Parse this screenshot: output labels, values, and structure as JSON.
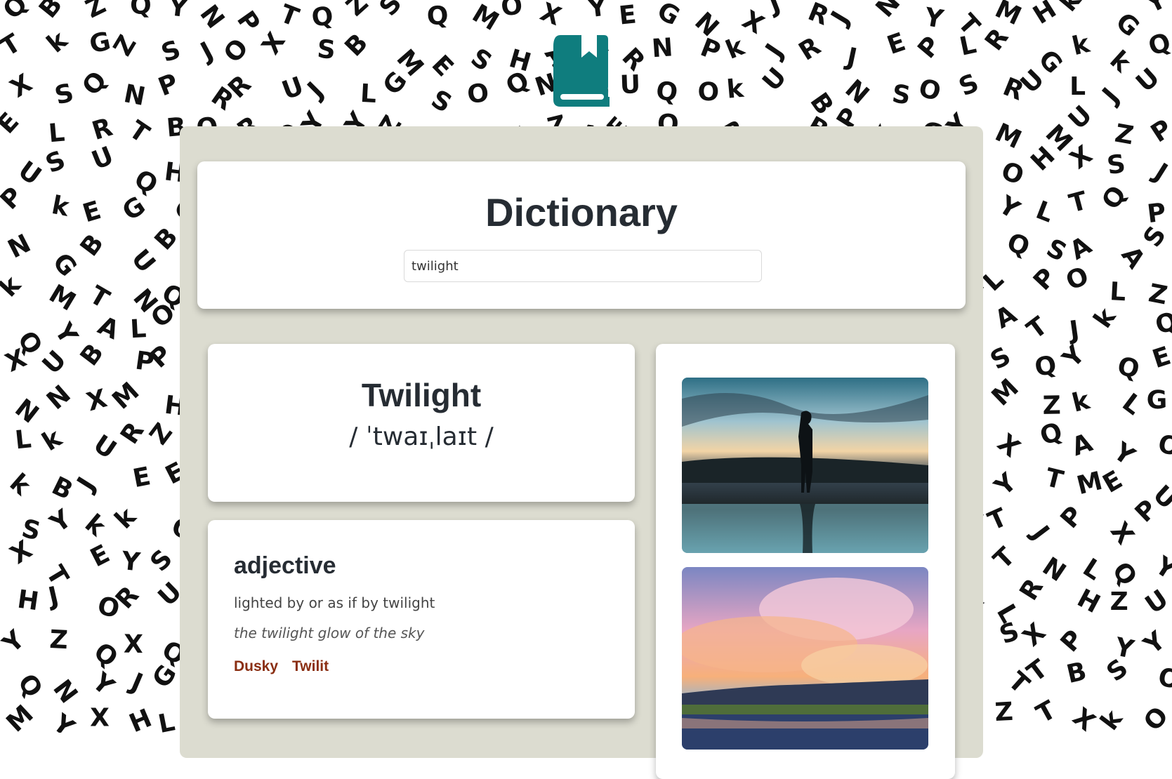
{
  "app": {
    "logo_icon": "bookmarked-book-icon",
    "accent_color": "#0f7d7e",
    "background_letters": "kOGPQTUJEYLAXMRZHBSN"
  },
  "header": {
    "title": "Dictionary",
    "search_value": "twilight"
  },
  "entry": {
    "word": "Twilight",
    "phonetic": "/ ˈtwaɪˌlaɪt /"
  },
  "meaning": {
    "part_of_speech": "adjective",
    "definition": "lighted by or as if by twilight",
    "example": "the twilight glow of the sky",
    "synonyms": [
      "Dusky",
      "Twilit"
    ]
  },
  "images": [
    {
      "description_icon": "silhouette-sunset-photo"
    },
    {
      "description_icon": "pink-cloud-sky-photo"
    }
  ]
}
